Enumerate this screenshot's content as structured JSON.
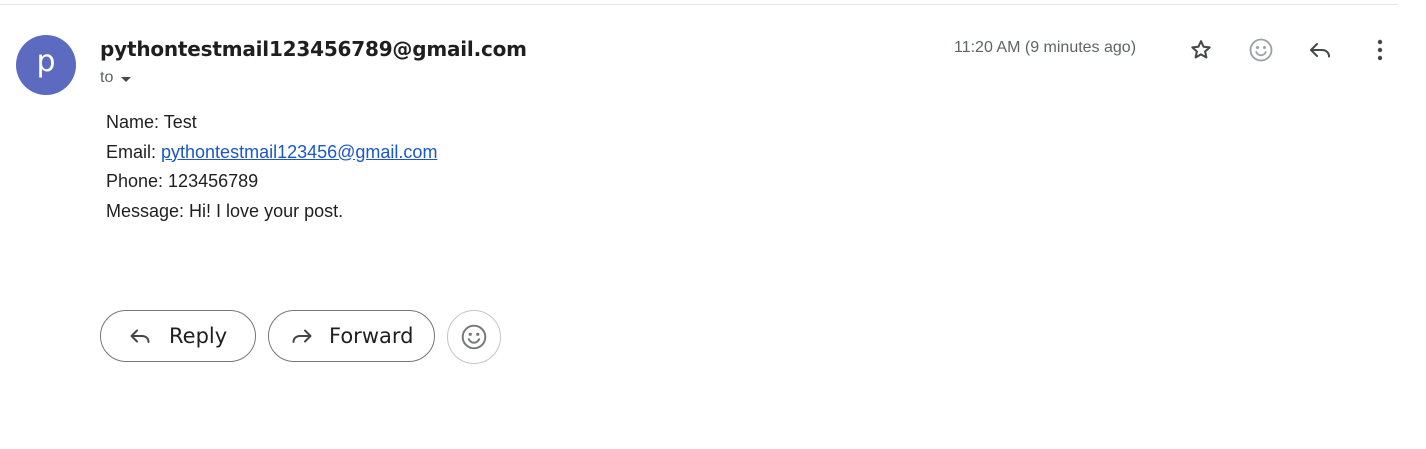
{
  "message": {
    "sender_initial": "p",
    "sender_email": "pythontestmail123456789@gmail.com",
    "recipient_label": "to",
    "timestamp": "11:20 AM (9 minutes ago)"
  },
  "header_icons": [
    "star-icon",
    "emoji-reaction-icon",
    "reply-icon",
    "more-vert-icon"
  ],
  "body": {
    "name_line": "Name: Test",
    "email_prefix": "Email: ",
    "email_link": "pythontestmail123456@gmail.com",
    "phone_line": "Phone: 123456789",
    "message_line": "Message: Hi! I love your post."
  },
  "actions": {
    "reply_label": "Reply",
    "forward_label": "Forward"
  },
  "colors": {
    "avatar": "#5c6bc0",
    "link": "#1a57c8",
    "muted_text": "#5f6368"
  }
}
